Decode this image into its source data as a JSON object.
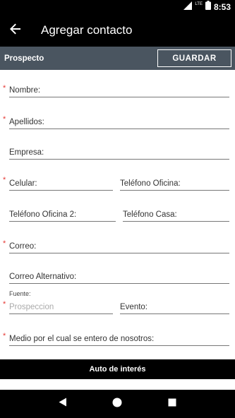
{
  "status_bar": {
    "network": "LTE",
    "time": "8:53"
  },
  "app_bar": {
    "title": "Agregar contacto"
  },
  "subbar": {
    "title": "Prospecto",
    "save_label": "GUARDAR"
  },
  "form": {
    "nombre": "Nombre:",
    "apellidos": "Apellidos:",
    "empresa": "Empresa:",
    "celular": "Celular:",
    "telefono_oficina": "Teléfono Oficina:",
    "telefono_oficina_2": "Teléfono Oficina 2:",
    "telefono_casa": "Teléfono Casa:",
    "correo": "Correo:",
    "correo_alternativo": "Correo Alternativo:",
    "fuente_label": "Fuente:",
    "fuente_value": "Prospeccion",
    "evento": "Evento:",
    "medio": "Medio por el cual se entero de nosotros:"
  },
  "section": {
    "title": "Auto de interés"
  },
  "required_marker": "*"
}
